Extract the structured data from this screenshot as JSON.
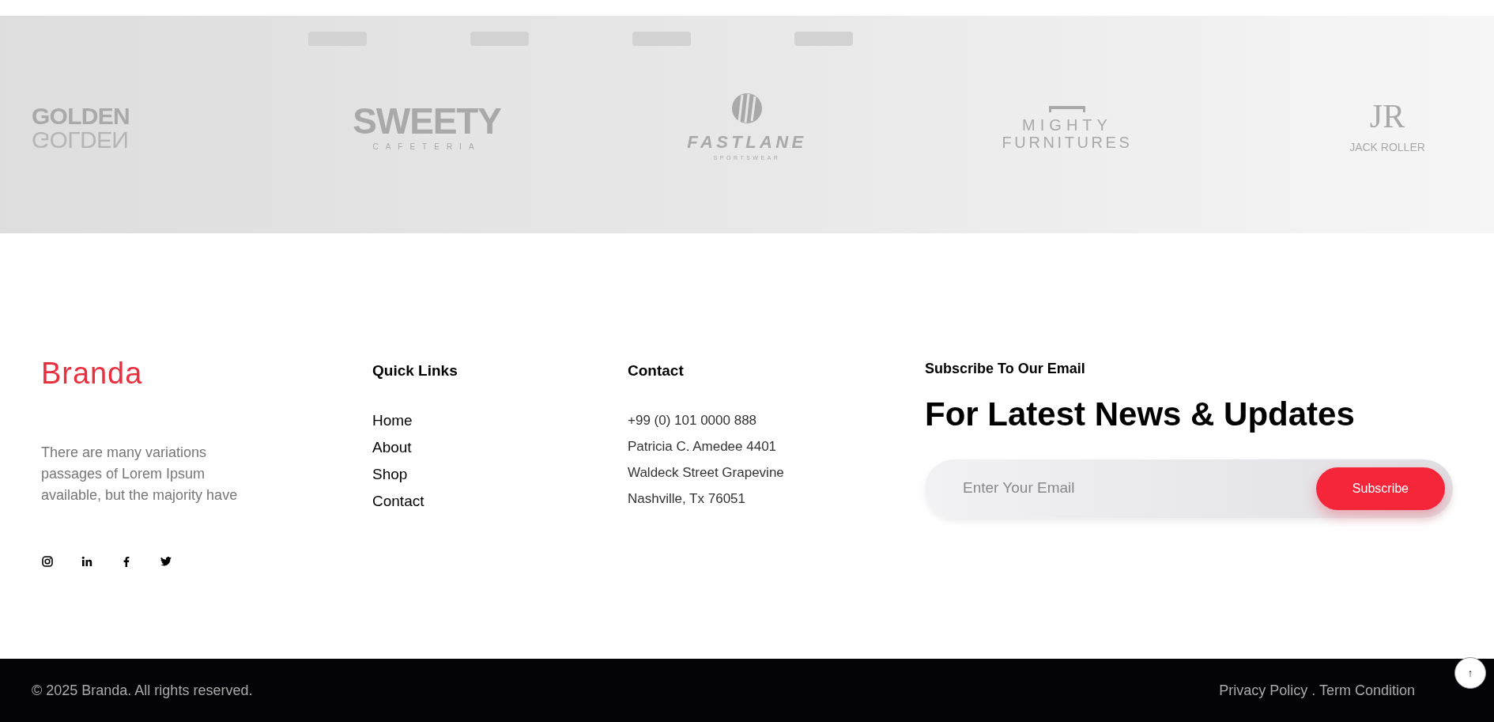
{
  "brands": [
    {
      "kind": "golden",
      "text": "GOLDEN",
      "reflection": "GOLDEN"
    },
    {
      "kind": "sweety",
      "text": "SWEETY",
      "sub": "CAFETERIA"
    },
    {
      "kind": "fastlane",
      "text": "FASTLANE",
      "sub": "SPORTSWEAR"
    },
    {
      "kind": "mighty",
      "text": "MIGHTY",
      "sub": "FURNITURES"
    },
    {
      "kind": "jr",
      "text": "JR",
      "sub": "JACK ROLLER"
    }
  ],
  "footer": {
    "brand": "Branda",
    "about": "There are many variations passages of Lorem Ipsum available, but the majority have",
    "socials": [
      {
        "kind": "instagram"
      },
      {
        "kind": "linkedin"
      },
      {
        "kind": "facebook"
      },
      {
        "kind": "twitter"
      }
    ],
    "quick_links": {
      "title": "Quick Links",
      "items": [
        "Home",
        "About",
        "Shop",
        "Contact"
      ]
    },
    "contact": {
      "title": "Contact",
      "lines": [
        "+99 (0) 101 0000 888",
        "Patricia C. Amedee 4401",
        "Waldeck Street Grapevine",
        "Nashville, Tx 76051"
      ]
    },
    "subscribe": {
      "title": "Subscribe To Our Email",
      "heading": "For Latest News & Updates",
      "placeholder": "Enter Your Email",
      "button": "Subscribe"
    }
  },
  "bottom_bar": {
    "copyright": "© 2025 Branda. All rights reserved.",
    "links": "Privacy Policy . Term Condition",
    "scroll_top": "↑"
  }
}
